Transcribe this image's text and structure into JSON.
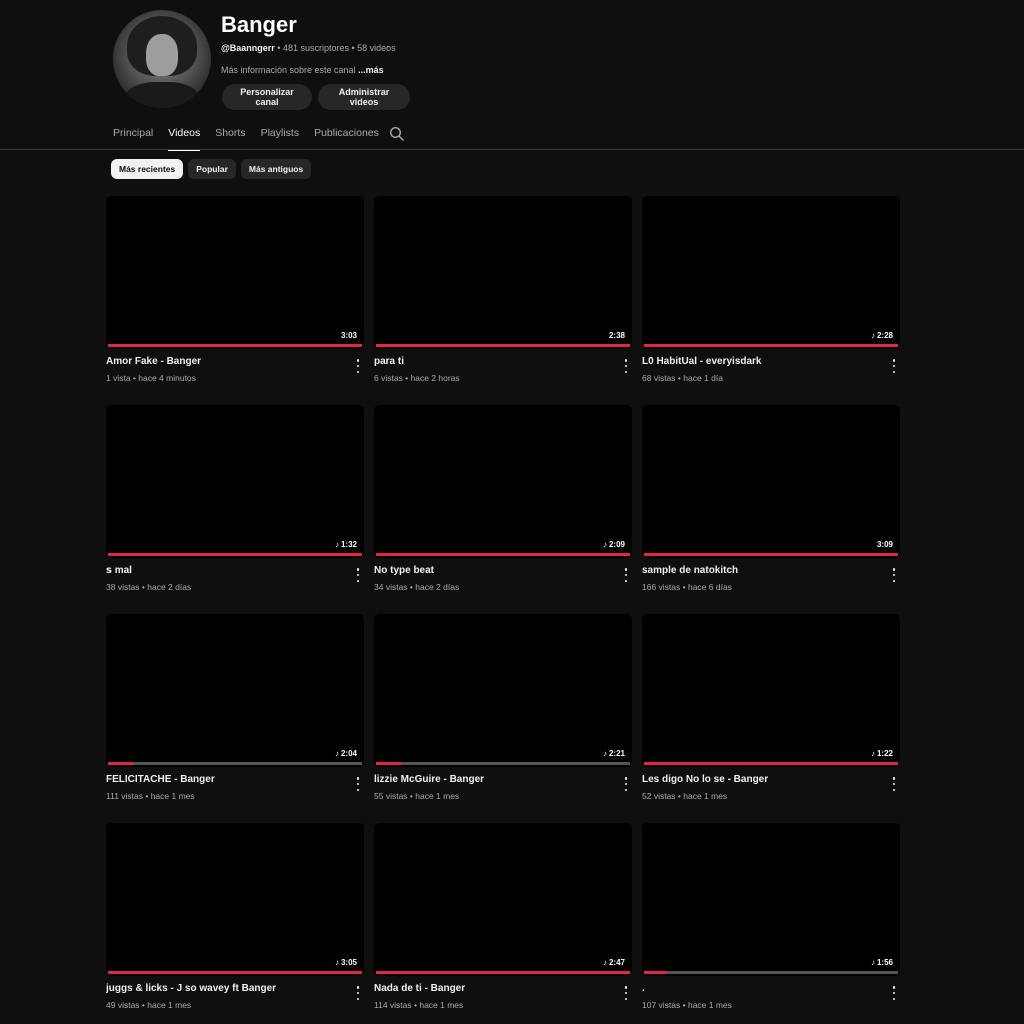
{
  "channel": {
    "name": "Banger",
    "handle": "@Baanngerr",
    "subscribers": "481 suscriptores",
    "video_count": "58 videos",
    "separator": " • ",
    "about": "Más información sobre este canal ",
    "about_more": "...más",
    "buttons": {
      "customize": "Personalizar canal",
      "manage": "Administrar videos"
    }
  },
  "tabs": [
    {
      "label": "Principal",
      "active": false
    },
    {
      "label": "Videos",
      "active": true
    },
    {
      "label": "Shorts",
      "active": false
    },
    {
      "label": "Playlists",
      "active": false
    },
    {
      "label": "Publicaciones",
      "active": false
    }
  ],
  "icons": {
    "search": "search-icon",
    "more": "more-vert-icon",
    "music": "music-note-icon"
  },
  "filters": [
    {
      "label": "Más recientes",
      "active": true
    },
    {
      "label": "Popular",
      "active": false
    },
    {
      "label": "Más antiguos",
      "active": false
    }
  ],
  "videos": [
    {
      "title": "Amor Fake - Banger",
      "meta": "1 vista • hace 4 minutos",
      "duration": "3:03",
      "music": false,
      "progress": 1.0
    },
    {
      "title": "para ti",
      "meta": "6 vistas • hace 2 horas",
      "duration": "2:38",
      "music": false,
      "progress": 1.0
    },
    {
      "title": "L0 HabitUal - everyisdark",
      "meta": "68 vistas • hace 1 día",
      "duration": "2:28",
      "music": true,
      "progress": 1.0
    },
    {
      "title": "ꜱ  mal",
      "meta": "38 vistas • hace 2 días",
      "duration": "1:32",
      "music": true,
      "progress": 1.0
    },
    {
      "title": "No type beat",
      "meta": "34 vistas • hace 2 días",
      "duration": "2:09",
      "music": true,
      "progress": 1.0
    },
    {
      "title": "sample de natokitch",
      "meta": "166 vistas • hace 6 días",
      "duration": "3:09",
      "music": false,
      "progress": 1.0
    },
    {
      "title": "FELICITACHE - Banger",
      "meta": "111 vistas • hace 1 mes",
      "duration": "2:04",
      "music": true,
      "progress": 0.1
    },
    {
      "title": "lizzie McGuire - Banger",
      "meta": "55 vistas • hace 1 mes",
      "duration": "2:21",
      "music": true,
      "progress": 0.1
    },
    {
      "title": "Les digo No lo se - Banger",
      "meta": "52 vistas • hace 1 mes",
      "duration": "1:22",
      "music": true,
      "progress": 1.0
    },
    {
      "title": "juggs & licks -  J so wavey ft Banger",
      "meta": "49 vistas • hace 1 mes",
      "duration": "3:05",
      "music": true,
      "progress": 1.0
    },
    {
      "title": "Nada de ti - Banger",
      "meta": "114 vistas • hace 1 mes",
      "duration": "2:47",
      "music": true,
      "progress": 1.0
    },
    {
      "title": ".",
      "meta": "107 vistas • hace 1 mes",
      "duration": "1:56",
      "music": true,
      "progress": 0.09
    }
  ],
  "colors": {
    "background": "#0f0f0f",
    "progress": "#e8224f",
    "chip_active": "#f1f1f1"
  }
}
